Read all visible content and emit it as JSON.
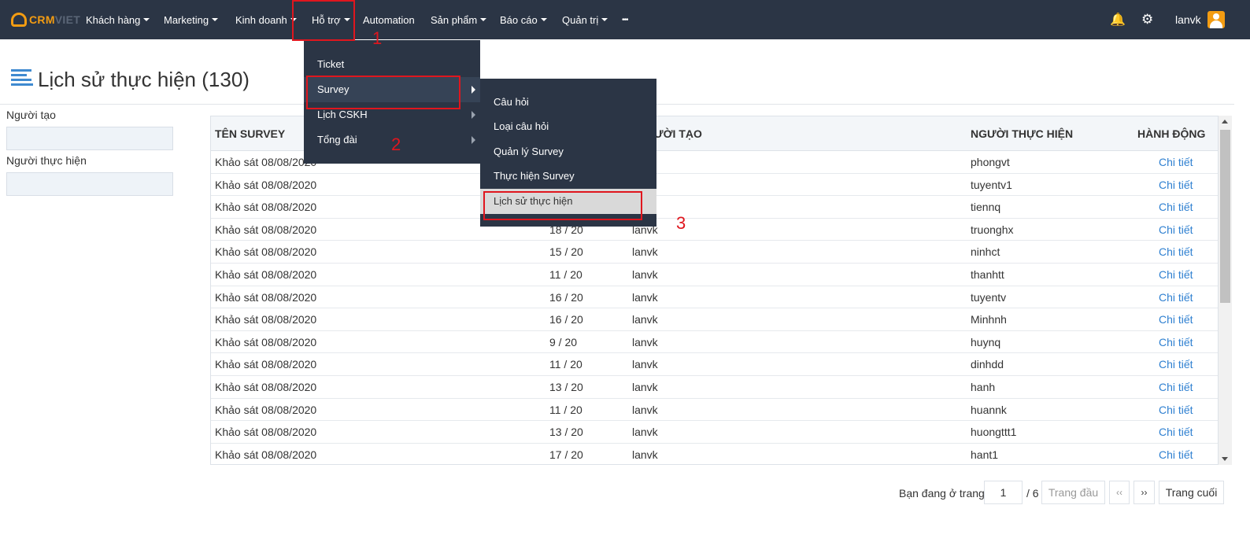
{
  "nav": {
    "logo_part1": "CRM",
    "logo_part2": "VIET",
    "items": [
      {
        "label": "Khách hàng",
        "has_caret": true
      },
      {
        "label": "Marketing",
        "has_caret": true
      },
      {
        "label": "Kinh doanh",
        "has_caret": true
      },
      {
        "label": "Hỗ trợ",
        "has_caret": true
      },
      {
        "label": "Automation",
        "has_caret": false
      },
      {
        "label": "Sản phẩm",
        "has_caret": true
      },
      {
        "label": "Báo cáo",
        "has_caret": true
      },
      {
        "label": "Quản trị",
        "has_caret": true
      },
      {
        "label": "•••",
        "has_caret": false
      }
    ],
    "bell_icon": "🔔",
    "gear_icon": "⚙",
    "username": "lanvk"
  },
  "page": {
    "title": "Lịch sử thực hiện (130)"
  },
  "filters": {
    "creator_label": "Người tạo",
    "creator_value": "",
    "performer_label": "Người thực hiện",
    "performer_value": ""
  },
  "table": {
    "headers": {
      "survey": "TÊN SURVEY",
      "creator": "NGƯỜI TẠO",
      "creator_visible": "ƯỜI TẠO",
      "performer": "NGƯỜI THỰC HIỆN",
      "action": "HÀNH ĐỘNG"
    },
    "rows": [
      {
        "survey": "Khảo sát 08/08/2020",
        "score": "",
        "creator": "",
        "performer": "phongvt",
        "action": "Chi tiết"
      },
      {
        "survey": "Khảo sát 08/08/2020",
        "score": "",
        "creator": "",
        "performer": "tuyentv1",
        "action": "Chi tiết"
      },
      {
        "survey": "Khảo sát 08/08/2020",
        "score": "",
        "creator": "",
        "performer": "tiennq",
        "action": "Chi tiết"
      },
      {
        "survey": "Khảo sát 08/08/2020",
        "score": "18 / 20",
        "creator": "lanvk",
        "performer": "truonghx",
        "action": "Chi tiết"
      },
      {
        "survey": "Khảo sát 08/08/2020",
        "score": "15 / 20",
        "creator": "lanvk",
        "performer": "ninhct",
        "action": "Chi tiết"
      },
      {
        "survey": "Khảo sát 08/08/2020",
        "score": "11 / 20",
        "creator": "lanvk",
        "performer": "thanhtt",
        "action": "Chi tiết"
      },
      {
        "survey": "Khảo sát 08/08/2020",
        "score": "16 / 20",
        "creator": "lanvk",
        "performer": "tuyentv",
        "action": "Chi tiết"
      },
      {
        "survey": "Khảo sát 08/08/2020",
        "score": "16 / 20",
        "creator": "lanvk",
        "performer": "Minhnh",
        "action": "Chi tiết"
      },
      {
        "survey": "Khảo sát 08/08/2020",
        "score": "9 / 20",
        "creator": "lanvk",
        "performer": "huynq",
        "action": "Chi tiết"
      },
      {
        "survey": "Khảo sát 08/08/2020",
        "score": "11 / 20",
        "creator": "lanvk",
        "performer": "dinhdd",
        "action": "Chi tiết"
      },
      {
        "survey": "Khảo sát 08/08/2020",
        "score": "13 / 20",
        "creator": "lanvk",
        "performer": "hanh",
        "action": "Chi tiết"
      },
      {
        "survey": "Khảo sát 08/08/2020",
        "score": "11 / 20",
        "creator": "lanvk",
        "performer": "huannk",
        "action": "Chi tiết"
      },
      {
        "survey": "Khảo sát 08/08/2020",
        "score": "13 / 20",
        "creator": "lanvk",
        "performer": "huongttt1",
        "action": "Chi tiết"
      },
      {
        "survey": "Khảo sát 08/08/2020",
        "score": "17 / 20",
        "creator": "lanvk",
        "performer": "hant1",
        "action": "Chi tiết"
      }
    ]
  },
  "pagination": {
    "label": "Bạn đang ở trang",
    "current": "1",
    "total": "/ 6",
    "first": "Trang đầu",
    "prev": "‹‹",
    "next": "››",
    "last": "Trang cuối"
  },
  "menu_support": {
    "items": [
      {
        "label": "Ticket"
      },
      {
        "label": "Survey"
      },
      {
        "label": "Lịch CSKH"
      },
      {
        "label": "Tổng đài"
      }
    ]
  },
  "menu_survey": {
    "items": [
      {
        "label": "Câu hỏi"
      },
      {
        "label": "Loại câu hỏi"
      },
      {
        "label": "Quản lý Survey"
      },
      {
        "label": "Thực hiện Survey"
      },
      {
        "label": "Lịch sử thực hiện"
      }
    ]
  },
  "annotations": {
    "step1": "1",
    "step2": "2",
    "step3": "3",
    "color": "#e0161e"
  },
  "colors": {
    "navbar": "#2b3545",
    "brand": "#f39c12",
    "link": "#2f80d1"
  }
}
